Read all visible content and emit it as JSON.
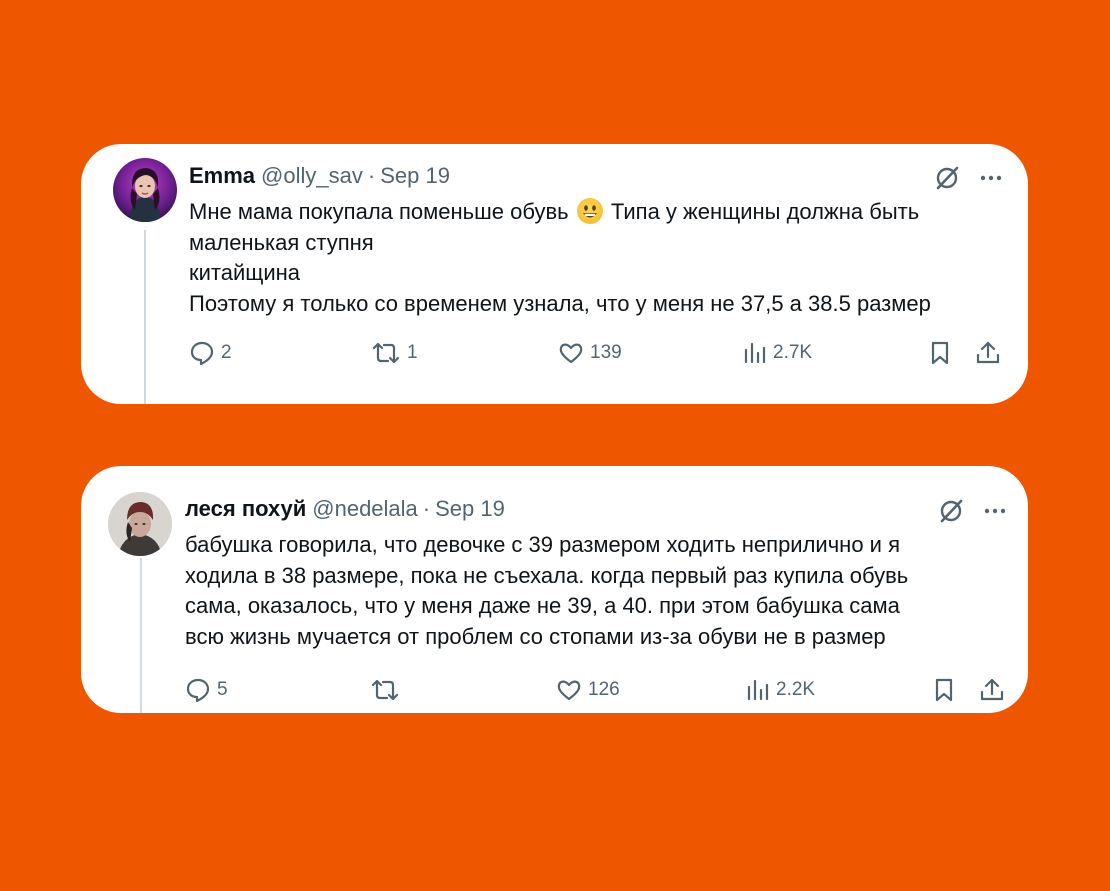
{
  "colors": {
    "background": "#ee5700",
    "card": "#ffffff",
    "text": "#0f1419",
    "secondary": "#536471",
    "thread_line": "#cfd9de"
  },
  "tweets": [
    {
      "name": "Emma",
      "handle": "@olly_sav",
      "separator": "·",
      "date": "Sep 19",
      "text_line1_a": "Мне мама покупала поменьше обувь",
      "emoji": "grinning-face-emoji",
      "text_line1_b": "Типа у женщины должна быть",
      "text_lines": [
        "маленькая ступня",
        "китайщина",
        "Поэтому я только со временем узнала, что у меня не 37,5 а 38.5 размер"
      ],
      "replies": "2",
      "retweets": "1",
      "likes": "139",
      "views": "2.7K"
    },
    {
      "name": "леся похуй",
      "handle": "@nedelala",
      "separator": "·",
      "date": "Sep 19",
      "text_lines": [
        "бабушка говорила, что девочке с 39 размером ходить неприлично и я",
        "ходила в 38 размере, пока не съехала. когда первый раз купила обувь",
        "сама, оказалось, что у меня даже не 39, а 40. при этом бабушка сама",
        "всю жизнь мучается от проблем со стопами из-за обуви не в размер"
      ],
      "replies": "5",
      "retweets": "",
      "likes": "126",
      "views": "2.2K"
    }
  ]
}
